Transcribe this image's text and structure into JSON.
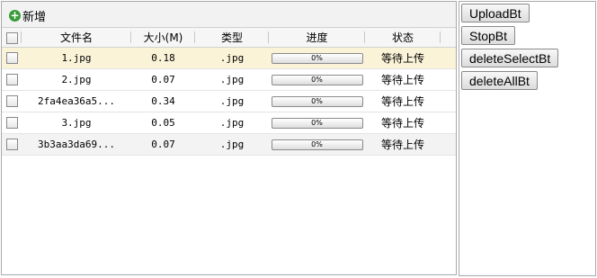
{
  "toolbar": {
    "add_label": "新增"
  },
  "columns": [
    "文件名",
    "大小(M)",
    "类型",
    "进度",
    "状态"
  ],
  "rows": [
    {
      "name": "1.jpg",
      "size": "0.18",
      "type": ".jpg",
      "progress": "0%",
      "status": "等待上传"
    },
    {
      "name": "2.jpg",
      "size": "0.07",
      "type": ".jpg",
      "progress": "0%",
      "status": "等待上传"
    },
    {
      "name": "2fa4ea36a5...",
      "size": "0.34",
      "type": ".jpg",
      "progress": "0%",
      "status": "等待上传"
    },
    {
      "name": "3.jpg",
      "size": "0.05",
      "type": ".jpg",
      "progress": "0%",
      "status": "等待上传"
    },
    {
      "name": "3b3aa3da69...",
      "size": "0.07",
      "type": ".jpg",
      "progress": "0%",
      "status": "等待上传"
    }
  ],
  "buttons": [
    "UploadBt",
    "StopBt",
    "deleteSelectBt",
    "deleteAllBt"
  ]
}
